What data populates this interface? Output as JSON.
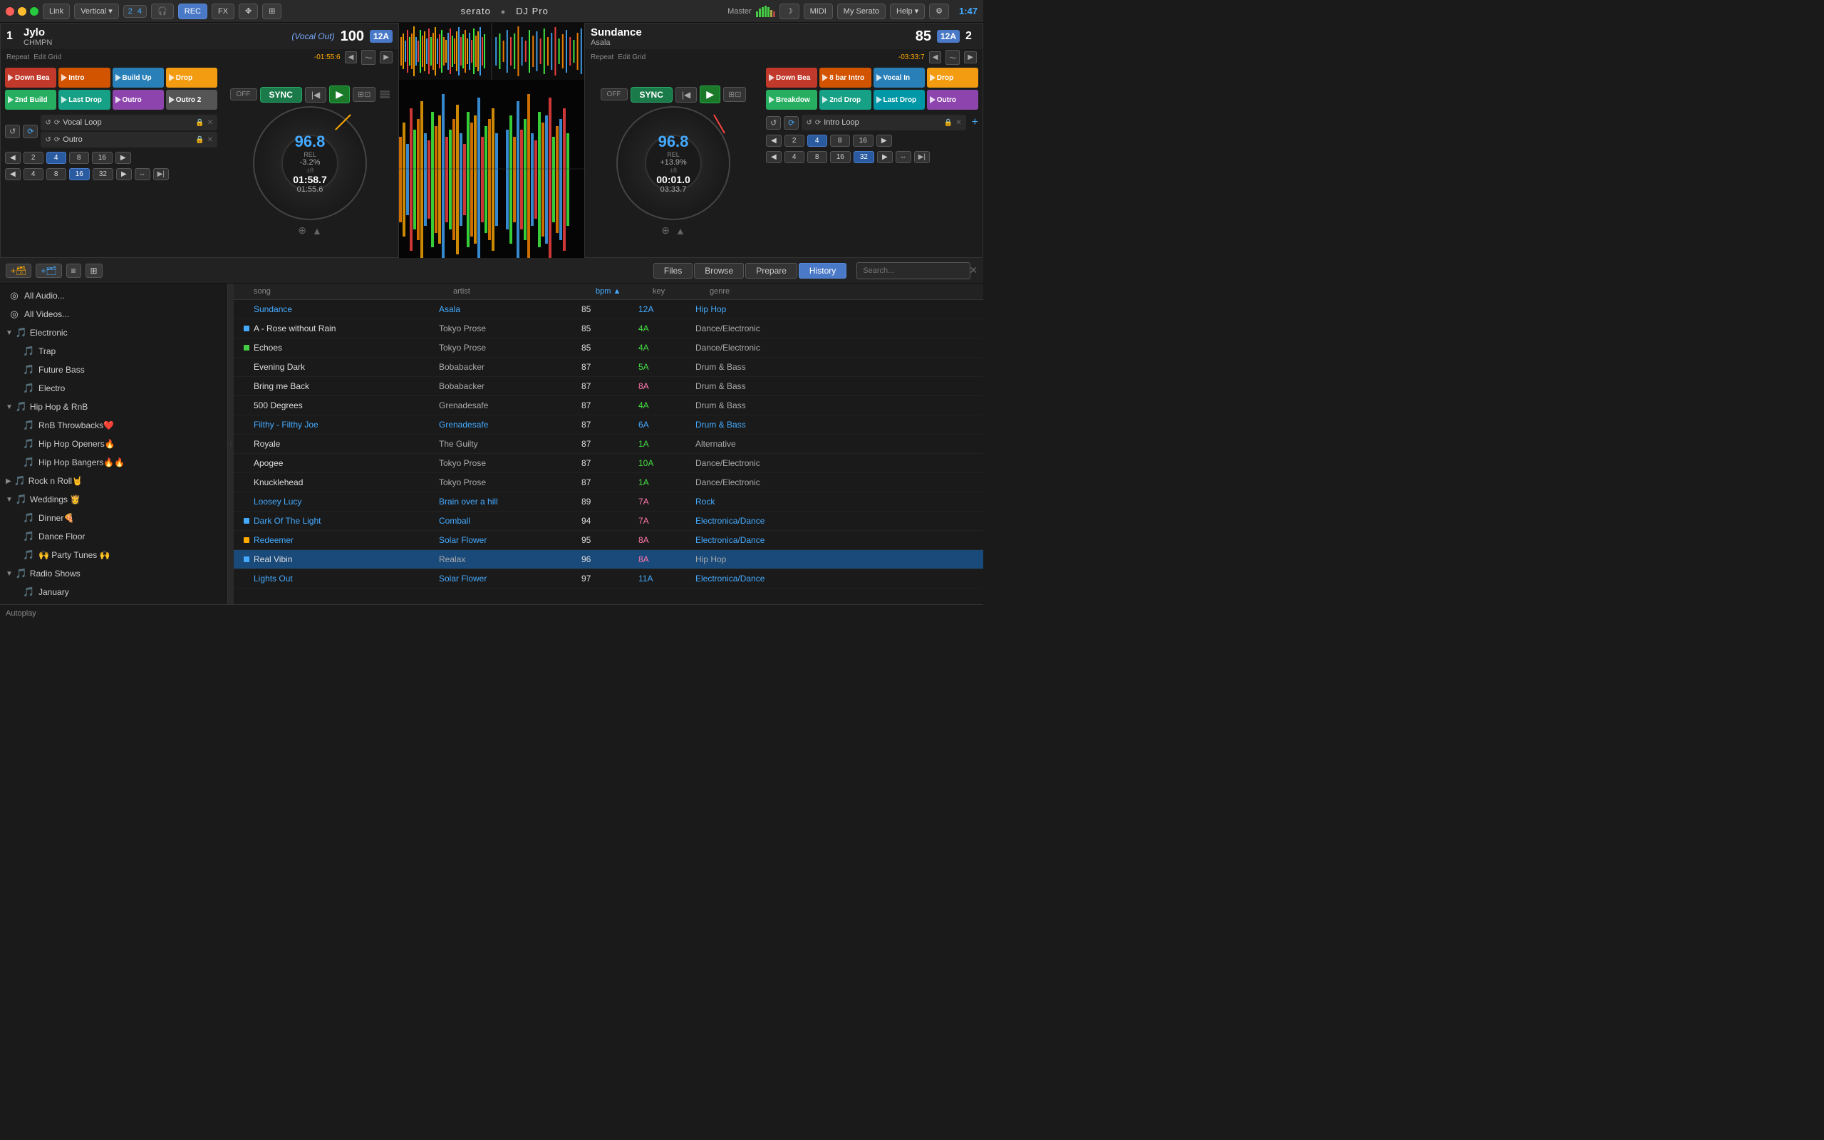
{
  "app": {
    "title": "Serato DJ Pro",
    "time": "1:47"
  },
  "topbar": {
    "link_label": "Link",
    "vertical_label": "Vertical",
    "rec_label": "REC",
    "fx_label": "FX",
    "midi_label": "MIDI",
    "myserato_label": "My Serato",
    "help_label": "Help",
    "master_label": "Master"
  },
  "deck1": {
    "number": "1",
    "title": "Jylo",
    "artist": "CHMPN",
    "status": "(Vocal Out)",
    "bpm": "100",
    "key": "12A",
    "repeat_label": "Repeat",
    "edit_grid_label": "Edit Grid",
    "time_display": "-01:55:6",
    "platter_bpm": "96.8",
    "platter_rel": "REL",
    "platter_pitch": "-3.2%",
    "platter_range": "±8",
    "platter_time1": "01:58.7",
    "platter_time2": "01:55.6",
    "cues": [
      {
        "label": "Down Bea",
        "color": "red"
      },
      {
        "label": "Intro",
        "color": "orange"
      },
      {
        "label": "Build Up",
        "color": "blue"
      },
      {
        "label": "Drop",
        "color": "yellow"
      },
      {
        "label": "2nd Build",
        "color": "green"
      },
      {
        "label": "Last Drop",
        "color": "teal"
      },
      {
        "label": "Outro",
        "color": "purple"
      },
      {
        "label": "Outro 2",
        "color": "gray"
      }
    ],
    "loops": [
      {
        "name": "Vocal Loop"
      },
      {
        "name": "Outro"
      }
    ],
    "sync_label": "SYNC",
    "off_label": "OFF",
    "beat_values": [
      "2",
      "4",
      "8",
      "16"
    ],
    "beat_values2": [
      "4",
      "8",
      "16",
      "32"
    ],
    "active_beat": "4",
    "active_beat2": "16"
  },
  "deck2": {
    "number": "2",
    "title": "Sundance",
    "artist": "Asala",
    "bpm": "85",
    "key": "12A",
    "repeat_label": "Repeat",
    "edit_grid_label": "Edit Grid",
    "time_display": "-03:33:7",
    "platter_bpm": "96.8",
    "platter_rel": "REL",
    "platter_pitch": "+13.9%",
    "platter_range": "±8",
    "platter_time1": "00:01.0",
    "platter_time2": "03:33.7",
    "cues": [
      {
        "label": "Down Bea",
        "color": "red"
      },
      {
        "label": "8 bar Intro",
        "color": "orange"
      },
      {
        "label": "Vocal In",
        "color": "blue"
      },
      {
        "label": "Drop",
        "color": "yellow"
      },
      {
        "label": "Breakdow",
        "color": "green"
      },
      {
        "label": "2nd Drop",
        "color": "teal"
      },
      {
        "label": "Last Drop",
        "color": "cyan"
      },
      {
        "label": "Outro",
        "color": "purple"
      }
    ],
    "loops": [
      {
        "name": "Intro Loop"
      }
    ],
    "sync_label": "SYNC",
    "off_label": "OFF",
    "beat_values": [
      "2",
      "4",
      "8",
      "16"
    ],
    "beat_values2": [
      "4",
      "8",
      "16",
      "32"
    ],
    "active_beat": "4",
    "active_beat2": "32"
  },
  "browser": {
    "toolbar": {
      "files_label": "Files",
      "browse_label": "Browse",
      "prepare_label": "Prepare",
      "history_label": "History",
      "search_placeholder": "Search..."
    },
    "columns": {
      "song": "song",
      "artist": "artist",
      "bpm": "bpm",
      "key": "key",
      "genre": "genre"
    },
    "sidebar": [
      {
        "id": "all-audio",
        "label": "All Audio...",
        "icon": "◎",
        "level": 0
      },
      {
        "id": "all-videos",
        "label": "All Videos...",
        "icon": "◎",
        "level": 0
      },
      {
        "id": "electronic",
        "label": "Electronic",
        "icon": "🎵",
        "level": 0,
        "expanded": true
      },
      {
        "id": "trap",
        "label": "Trap",
        "icon": "🎵",
        "level": 1
      },
      {
        "id": "future-bass",
        "label": "Future Bass",
        "icon": "🎵",
        "level": 1
      },
      {
        "id": "electro",
        "label": "Electro",
        "icon": "🎵",
        "level": 1
      },
      {
        "id": "hiphop",
        "label": "Hip Hop & RnB",
        "icon": "🎵",
        "level": 0,
        "expanded": true
      },
      {
        "id": "rnb-throwbacks",
        "label": "RnB Throwbacks❤️",
        "icon": "🎵",
        "level": 1
      },
      {
        "id": "hiphop-openers",
        "label": "Hip Hop Openers🔥",
        "icon": "🎵",
        "level": 1
      },
      {
        "id": "hiphop-bangers",
        "label": "Hip Hop Bangers🔥🔥",
        "icon": "🎵",
        "level": 1
      },
      {
        "id": "rocknroll",
        "label": "Rock n Roll🤘",
        "icon": "🎵",
        "level": 0
      },
      {
        "id": "weddings",
        "label": "Weddings 👸",
        "icon": "🎵",
        "level": 0,
        "expanded": true
      },
      {
        "id": "dinner",
        "label": "Dinner🍕",
        "icon": "🎵",
        "level": 1
      },
      {
        "id": "dance-floor",
        "label": "Dance Floor",
        "icon": "🎵",
        "level": 1
      },
      {
        "id": "party-tunes",
        "label": "🙌 Party Tunes 🙌",
        "icon": "🎵",
        "level": 1
      },
      {
        "id": "radio-shows",
        "label": "Radio Shows",
        "icon": "🎵",
        "level": 0,
        "expanded": true
      },
      {
        "id": "january",
        "label": "January",
        "icon": "🎵",
        "level": 1
      }
    ],
    "tracks": [
      {
        "song": "Sundance",
        "artist": "Asala",
        "bpm": "85",
        "key": "12A",
        "genre": "Hip Hop",
        "highlight": true,
        "indicator": "none"
      },
      {
        "song": "A - Rose without Rain",
        "artist": "Tokyo Prose",
        "bpm": "85",
        "key": "4A",
        "genre": "Dance/Electronic",
        "highlight": false,
        "indicator": "blue"
      },
      {
        "song": "Echoes",
        "artist": "Tokyo Prose",
        "bpm": "85",
        "key": "4A",
        "genre": "Dance/Electronic",
        "highlight": false,
        "indicator": "green"
      },
      {
        "song": "Evening Dark",
        "artist": "Bobabacker",
        "bpm": "87",
        "key": "5A",
        "genre": "Drum & Bass",
        "highlight": false,
        "indicator": "none"
      },
      {
        "song": "Bring me Back",
        "artist": "Bobabacker",
        "bpm": "87",
        "key": "8A",
        "genre": "Drum & Bass",
        "highlight": false,
        "indicator": "none",
        "key_color": "pink"
      },
      {
        "song": "500 Degrees",
        "artist": "Grenadesafe",
        "bpm": "87",
        "key": "4A",
        "genre": "Drum & Bass",
        "highlight": false,
        "indicator": "none"
      },
      {
        "song": "Filthy - Filthy Joe",
        "artist": "Grenadesafe",
        "bpm": "87",
        "key": "6A",
        "genre": "Drum & Bass",
        "highlight": true,
        "indicator": "none"
      },
      {
        "song": "Royale",
        "artist": "The Guilty",
        "bpm": "87",
        "key": "1A",
        "genre": "Alternative",
        "highlight": false,
        "indicator": "none"
      },
      {
        "song": "Apogee",
        "artist": "Tokyo Prose",
        "bpm": "87",
        "key": "10A",
        "genre": "Dance/Electronic",
        "highlight": false,
        "indicator": "none"
      },
      {
        "song": "Knucklehead",
        "artist": "Tokyo Prose",
        "bpm": "87",
        "key": "1A",
        "genre": "Dance/Electronic",
        "highlight": false,
        "indicator": "none"
      },
      {
        "song": "Loosey Lucy",
        "artist": "Brain over a hill",
        "bpm": "89",
        "key": "7A",
        "genre": "Rock",
        "highlight": true,
        "indicator": "none",
        "key_color": "pink"
      },
      {
        "song": "Dark Of The Light",
        "artist": "Comball",
        "bpm": "94",
        "key": "7A",
        "genre": "Electronica/Dance",
        "highlight": true,
        "indicator": "blue",
        "key_color": "pink"
      },
      {
        "song": "Redeemer",
        "artist": "Solar Flower",
        "bpm": "95",
        "key": "8A",
        "genre": "Electronica/Dance",
        "highlight": true,
        "indicator": "yellow",
        "key_color": "pink"
      },
      {
        "song": "Real Vibin",
        "artist": "Realax",
        "bpm": "96",
        "key": "8A",
        "genre": "Hip Hop",
        "highlight": false,
        "indicator": "blue",
        "selected": true,
        "key_color": "pink"
      },
      {
        "song": "Lights Out",
        "artist": "Solar Flower",
        "bpm": "97",
        "key": "11A",
        "genre": "Electronica/Dance",
        "highlight": true,
        "indicator": "none"
      }
    ],
    "autoplay_label": "Autoplay"
  }
}
